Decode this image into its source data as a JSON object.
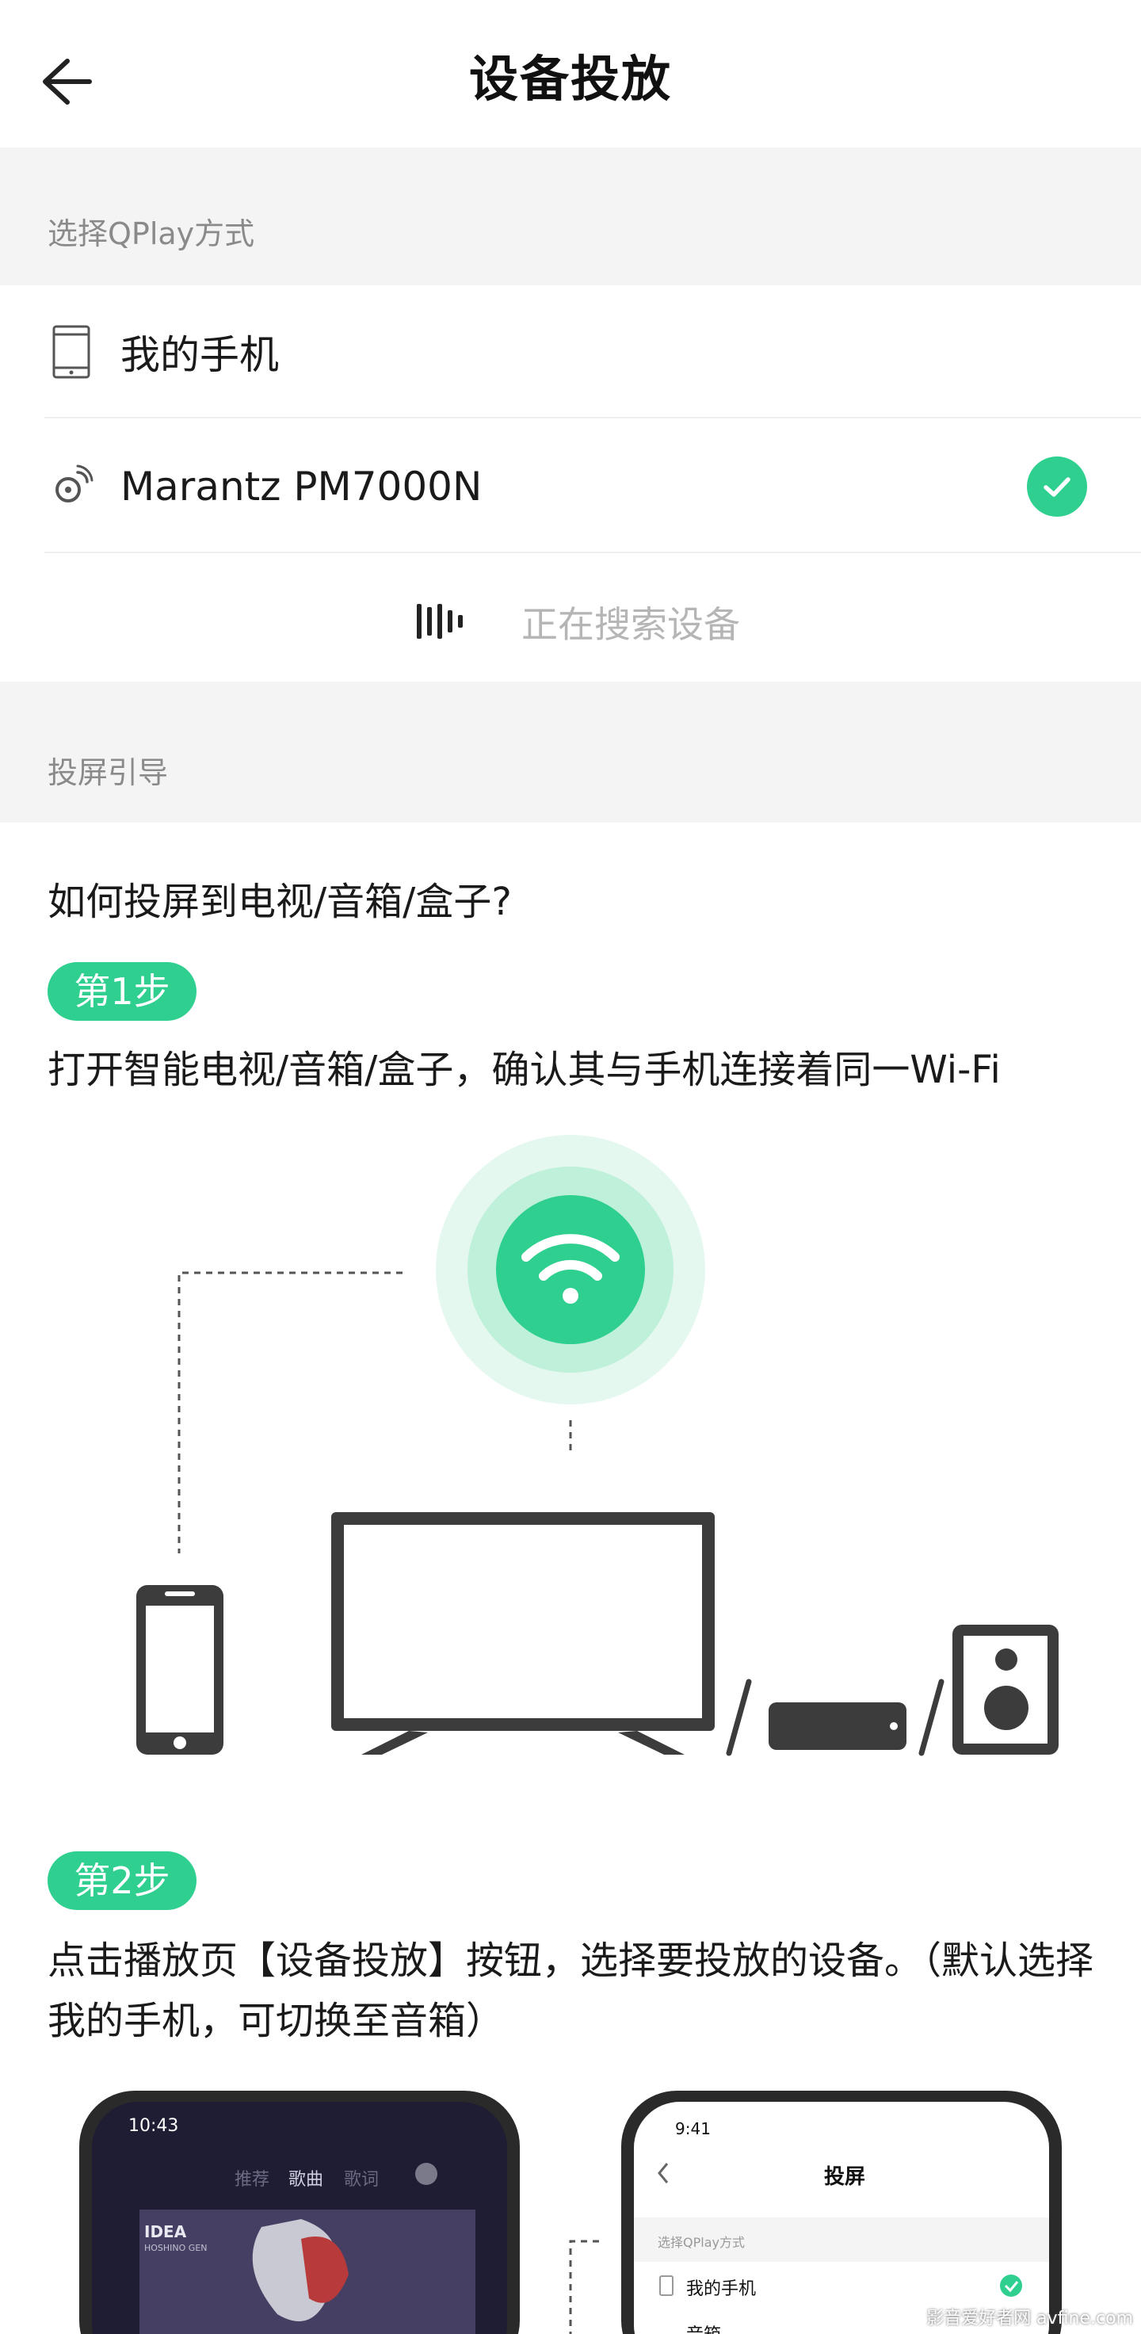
{
  "header": {
    "title": "设备投放",
    "back_icon": "arrow-left-icon"
  },
  "qplay_section": {
    "title": "选择QPlay方式",
    "devices": [
      {
        "label": "我的手机",
        "icon": "phone-icon",
        "selected": false
      },
      {
        "label": "Marantz PM7000N",
        "icon": "speaker-cast-icon",
        "selected": true
      }
    ],
    "searching_text": "正在搜索设备"
  },
  "guide_section": {
    "title": "投屏引导",
    "question": "如何投屏到电视/音箱/盒子?",
    "steps": [
      {
        "badge": "第1步",
        "text": "打开智能电视/音箱/盒子，确认其与手机连接着同一Wi-Fi"
      },
      {
        "badge": "第2步",
        "text": "点击播放页【设备投放】按钮，选择要投放的设备。（默认选择我的手机，可切换至音箱）"
      }
    ]
  },
  "preview_phones": {
    "left": {
      "time": "10:43",
      "tabs": [
        "推荐",
        "歌曲",
        "歌词"
      ],
      "album_title": "IDEA",
      "album_subtitle": "HOSHINO GEN"
    },
    "right": {
      "time": "9:41",
      "title": "投屏",
      "section": "选择QPlay方式",
      "item": "我的手机",
      "item2": "音箱"
    }
  },
  "watermark": "影音爱好者网 avfine.com",
  "colors": {
    "accent": "#2fcf8f",
    "section_bg": "#f4f4f4",
    "muted_text": "#8a8a8a",
    "icon_dark": "#3c3c3c"
  }
}
